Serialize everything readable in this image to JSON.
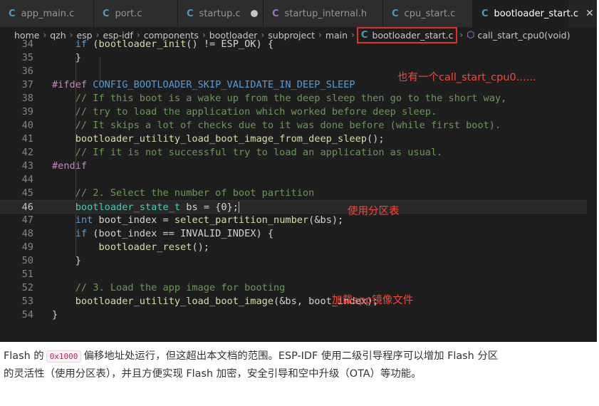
{
  "tabs": [
    {
      "icon": "C",
      "kind": "c",
      "label": "app_main.c",
      "active": false,
      "modified": false
    },
    {
      "icon": "C",
      "kind": "c",
      "label": "port.c",
      "active": false,
      "modified": false
    },
    {
      "icon": "C",
      "kind": "c",
      "label": "startup.c",
      "active": false,
      "modified": true
    },
    {
      "icon": "C",
      "kind": "h",
      "label": "startup_internal.h",
      "active": false,
      "modified": false
    },
    {
      "icon": "C",
      "kind": "c",
      "label": "cpu_start.c",
      "active": false,
      "modified": false
    },
    {
      "icon": "C",
      "kind": "c",
      "label": "bootloader_start.c",
      "active": true,
      "modified": false
    }
  ],
  "close_glyph": "✕",
  "breadcrumb": {
    "parts": [
      "home",
      "qzh",
      "esp",
      "esp-idf",
      "components",
      "bootloader",
      "subproject",
      "main"
    ],
    "file_icon": "C",
    "file": "bootloader_start.c",
    "symbol": "call_start_cpu0(void)"
  },
  "code": {
    "current_line": 46,
    "lines": [
      {
        "n": "34",
        "t": [
          [
            "pl",
            "    "
          ],
          [
            "kw",
            "if"
          ],
          [
            "pl",
            " ("
          ],
          [
            "fn",
            "bootloader_init"
          ],
          [
            "pl",
            "() != ESP_OK) {"
          ]
        ]
      },
      {
        "n": "35",
        "t": [
          [
            "pl",
            "    }"
          ]
        ]
      },
      {
        "n": "36",
        "t": []
      },
      {
        "n": "37",
        "t": [
          [
            "pp",
            "#ifdef"
          ],
          [
            "pl",
            " "
          ],
          [
            "macro",
            "CONFIG_BOOTLOADER_SKIP_VALIDATE_IN_DEEP_SLEEP"
          ]
        ]
      },
      {
        "n": "38",
        "t": [
          [
            "cm",
            "    // If this boot is a wake up from the deep sleep then go to the short way,"
          ]
        ]
      },
      {
        "n": "39",
        "t": [
          [
            "cm",
            "    // try to load the application which worked before deep sleep."
          ]
        ]
      },
      {
        "n": "40",
        "t": [
          [
            "cm",
            "    // It skips a lot of checks due to it was done before (while first boot)."
          ]
        ]
      },
      {
        "n": "41",
        "t": [
          [
            "pl",
            "    "
          ],
          [
            "fn",
            "bootloader_utility_load_boot_image_from_deep_sleep"
          ],
          [
            "pl",
            "();"
          ]
        ]
      },
      {
        "n": "42",
        "t": [
          [
            "cm",
            "    // If it is not successful try to load an application as usual."
          ]
        ]
      },
      {
        "n": "43",
        "t": [
          [
            "pp",
            "#endif"
          ]
        ]
      },
      {
        "n": "44",
        "t": []
      },
      {
        "n": "45",
        "t": [
          [
            "cm",
            "    // 2. Select the number of boot partition"
          ]
        ]
      },
      {
        "n": "46",
        "t": [
          [
            "pl",
            "    "
          ],
          [
            "type",
            "bootloader_state_t"
          ],
          [
            "pl",
            " bs = {0};"
          ]
        ]
      },
      {
        "n": "47",
        "t": [
          [
            "pl",
            "    "
          ],
          [
            "kw",
            "int"
          ],
          [
            "pl",
            " boot_index = "
          ],
          [
            "fn",
            "select_partition_number"
          ],
          [
            "pl",
            "(&bs);"
          ]
        ]
      },
      {
        "n": "48",
        "t": [
          [
            "pl",
            "    "
          ],
          [
            "kw",
            "if"
          ],
          [
            "pl",
            " (boot_index == INVALID_INDEX) {"
          ]
        ]
      },
      {
        "n": "49",
        "t": [
          [
            "pl",
            "        "
          ],
          [
            "fn",
            "bootloader_reset"
          ],
          [
            "pl",
            "();"
          ]
        ]
      },
      {
        "n": "50",
        "t": [
          [
            "pl",
            "    }"
          ]
        ]
      },
      {
        "n": "51",
        "t": []
      },
      {
        "n": "52",
        "t": [
          [
            "cm",
            "    // 3. Load the app image for booting"
          ]
        ]
      },
      {
        "n": "53",
        "t": [
          [
            "pl",
            "    "
          ],
          [
            "fn",
            "bootloader_utility_load_boot_image"
          ],
          [
            "pl",
            "(&bs, boot_index);"
          ]
        ]
      },
      {
        "n": "54",
        "t": [
          [
            "pl",
            "}"
          ]
        ]
      }
    ],
    "reset_line": {
      "n": "35",
      "text": "bootloader_reset"
    }
  },
  "annotations": {
    "a1": "也有一个call_start_cpu0......",
    "a2": "使用分区表",
    "a3": "加载app镜像文件"
  },
  "doc": {
    "pre": "Flash 的",
    "code": "0x1000",
    "post": "偏移地址处运行，但这超出本文档的范围。ESP-IDF 使用二级引导程序可以增加 Flash 分区的灵活性（使用分区表），并且方便实现 Flash 加密，安全引导和空中升级（OTA）等功能。"
  },
  "colors": {
    "accent_red": "#e0312b",
    "annot_red": "#f04a3a",
    "editor_bg": "#1e1e1e"
  }
}
